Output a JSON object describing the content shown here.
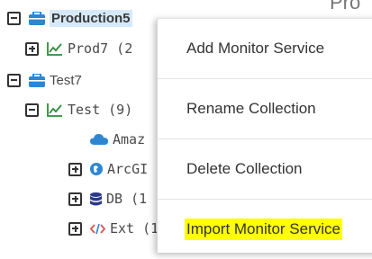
{
  "colors": {
    "accent_blue": "#2e86d1",
    "chart_green": "#2e8b3a",
    "selection_bg": "#d6e9f8",
    "highlight_yellow": "#ffff00",
    "db_navy": "#2a3a8a"
  },
  "header": {
    "partial_title": "Pro"
  },
  "tree": {
    "production": {
      "label": "Production5",
      "icon": "collection-icon",
      "expanded": true,
      "selected": true
    },
    "prod7": {
      "label": "Prod7 (2",
      "icon": "chart-line-icon",
      "expanded": false
    },
    "test7": {
      "label": "Test7",
      "icon": "collection-icon",
      "expanded": true
    },
    "test": {
      "label": "Test (9)",
      "icon": "chart-line-icon",
      "expanded": true
    },
    "amazon": {
      "label": "Amaz",
      "icon": "cloud-icon"
    },
    "arcgis": {
      "label": "ArcGI",
      "icon": "globe-icon",
      "expanded": false
    },
    "db": {
      "label": "DB (1",
      "icon": "database-icon",
      "expanded": false
    },
    "ext": {
      "label": "Ext (1",
      "icon": "code-icon",
      "expanded": false
    }
  },
  "context_menu": {
    "items": [
      {
        "label": "Add Monitor Service",
        "highlighted": false
      },
      {
        "label": "Rename Collection",
        "highlighted": false
      },
      {
        "label": "Delete Collection",
        "highlighted": false
      },
      {
        "label": "Import Monitor Service",
        "highlighted": true
      }
    ]
  }
}
